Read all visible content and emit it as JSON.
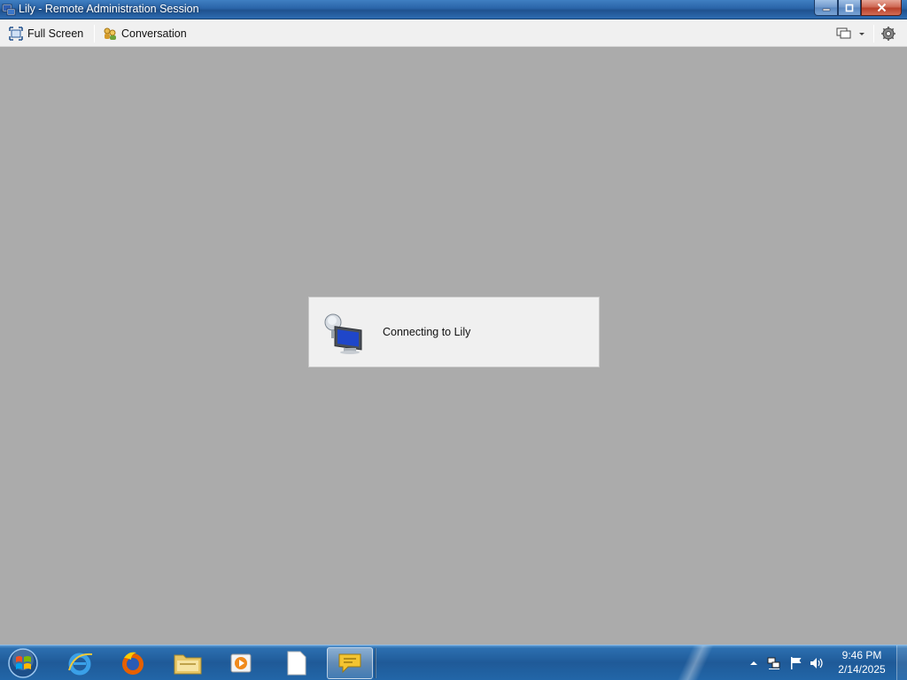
{
  "window": {
    "title": "Lily - Remote Administration Session",
    "controls": {
      "minimize": "minimize-icon",
      "restore": "restore-icon",
      "close": "close-icon"
    }
  },
  "toolbar": {
    "full_screen_label": "Full Screen",
    "conversation_label": "Conversation",
    "icons": [
      "full-screen-icon",
      "conversation-icon",
      "monitor-select-icon",
      "dropdown-arrow-icon",
      "settings-gear-icon"
    ]
  },
  "connecting": {
    "message": "Connecting to Lily",
    "icon": "remote-connection-icon"
  },
  "taskbar": {
    "pinned": [
      {
        "name": "internet-explorer-icon",
        "active": false
      },
      {
        "name": "firefox-icon",
        "active": false
      },
      {
        "name": "file-explorer-icon",
        "active": false
      },
      {
        "name": "media-player-icon",
        "active": false
      },
      {
        "name": "blank-document-icon",
        "active": false
      },
      {
        "name": "chat-bubble-icon",
        "active": true
      }
    ],
    "tray_icons": [
      "show-hidden-icons-arrow",
      "network-icon",
      "action-center-flag-icon",
      "volume-icon"
    ],
    "clock": {
      "time": "9:46 PM",
      "date": "2/14/2025"
    }
  },
  "colors": {
    "titlebar": "#2a64a8",
    "toolbar": "#f0f0f0",
    "remote_background": "#ababab",
    "dialog": "#f0f0f0",
    "taskbar": "#1f5a98"
  }
}
